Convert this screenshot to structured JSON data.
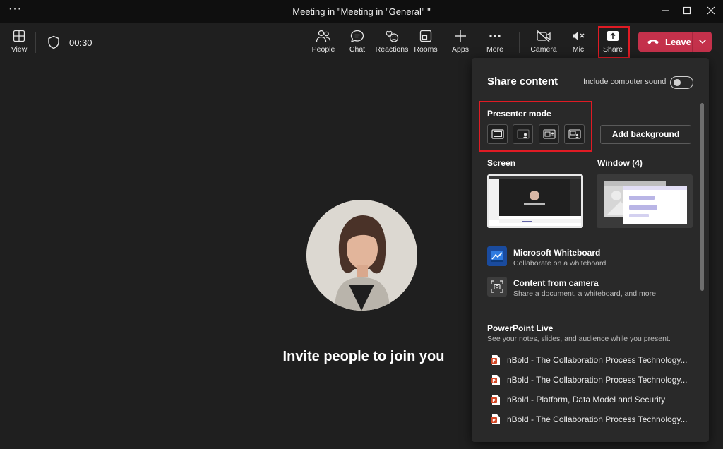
{
  "window": {
    "title": "Meeting in \"Meeting in \"General\" \"",
    "more_glyph": "···"
  },
  "toolbar": {
    "view_label": "View",
    "timer": "00:30",
    "people_label": "People",
    "chat_label": "Chat",
    "reactions_label": "Reactions",
    "rooms_label": "Rooms",
    "apps_label": "Apps",
    "more_label": "More",
    "camera_label": "Camera",
    "mic_label": "Mic",
    "share_label": "Share",
    "leave_label": "Leave",
    "accent_leave": "#c4314b",
    "highlight": "#e01b24"
  },
  "stage": {
    "invite_text": "Invite people to join you"
  },
  "share_panel": {
    "title": "Share content",
    "include_sound_label": "Include computer sound",
    "include_sound_on": false,
    "presenter_mode_label": "Presenter mode",
    "presenter_modes": [
      "content-only-icon",
      "standout-icon",
      "side-by-side-icon",
      "reporter-icon"
    ],
    "add_background_label": "Add background",
    "screen_label": "Screen",
    "window_label": "Window (4)",
    "whiteboard": {
      "title": "Microsoft Whiteboard",
      "subtitle": "Collaborate on a whiteboard"
    },
    "camera_content": {
      "title": "Content from camera",
      "subtitle": "Share a document, a whiteboard, and more"
    },
    "powerpoint_live": {
      "title": "PowerPoint Live",
      "subtitle": "See your notes, slides, and audience while you present."
    },
    "files": [
      "nBold - The Collaboration Process Technology...",
      "nBold - The Collaboration Process Technology...",
      "nBold - Platform, Data Model and Security",
      "nBold - The Collaboration Process Technology..."
    ]
  }
}
